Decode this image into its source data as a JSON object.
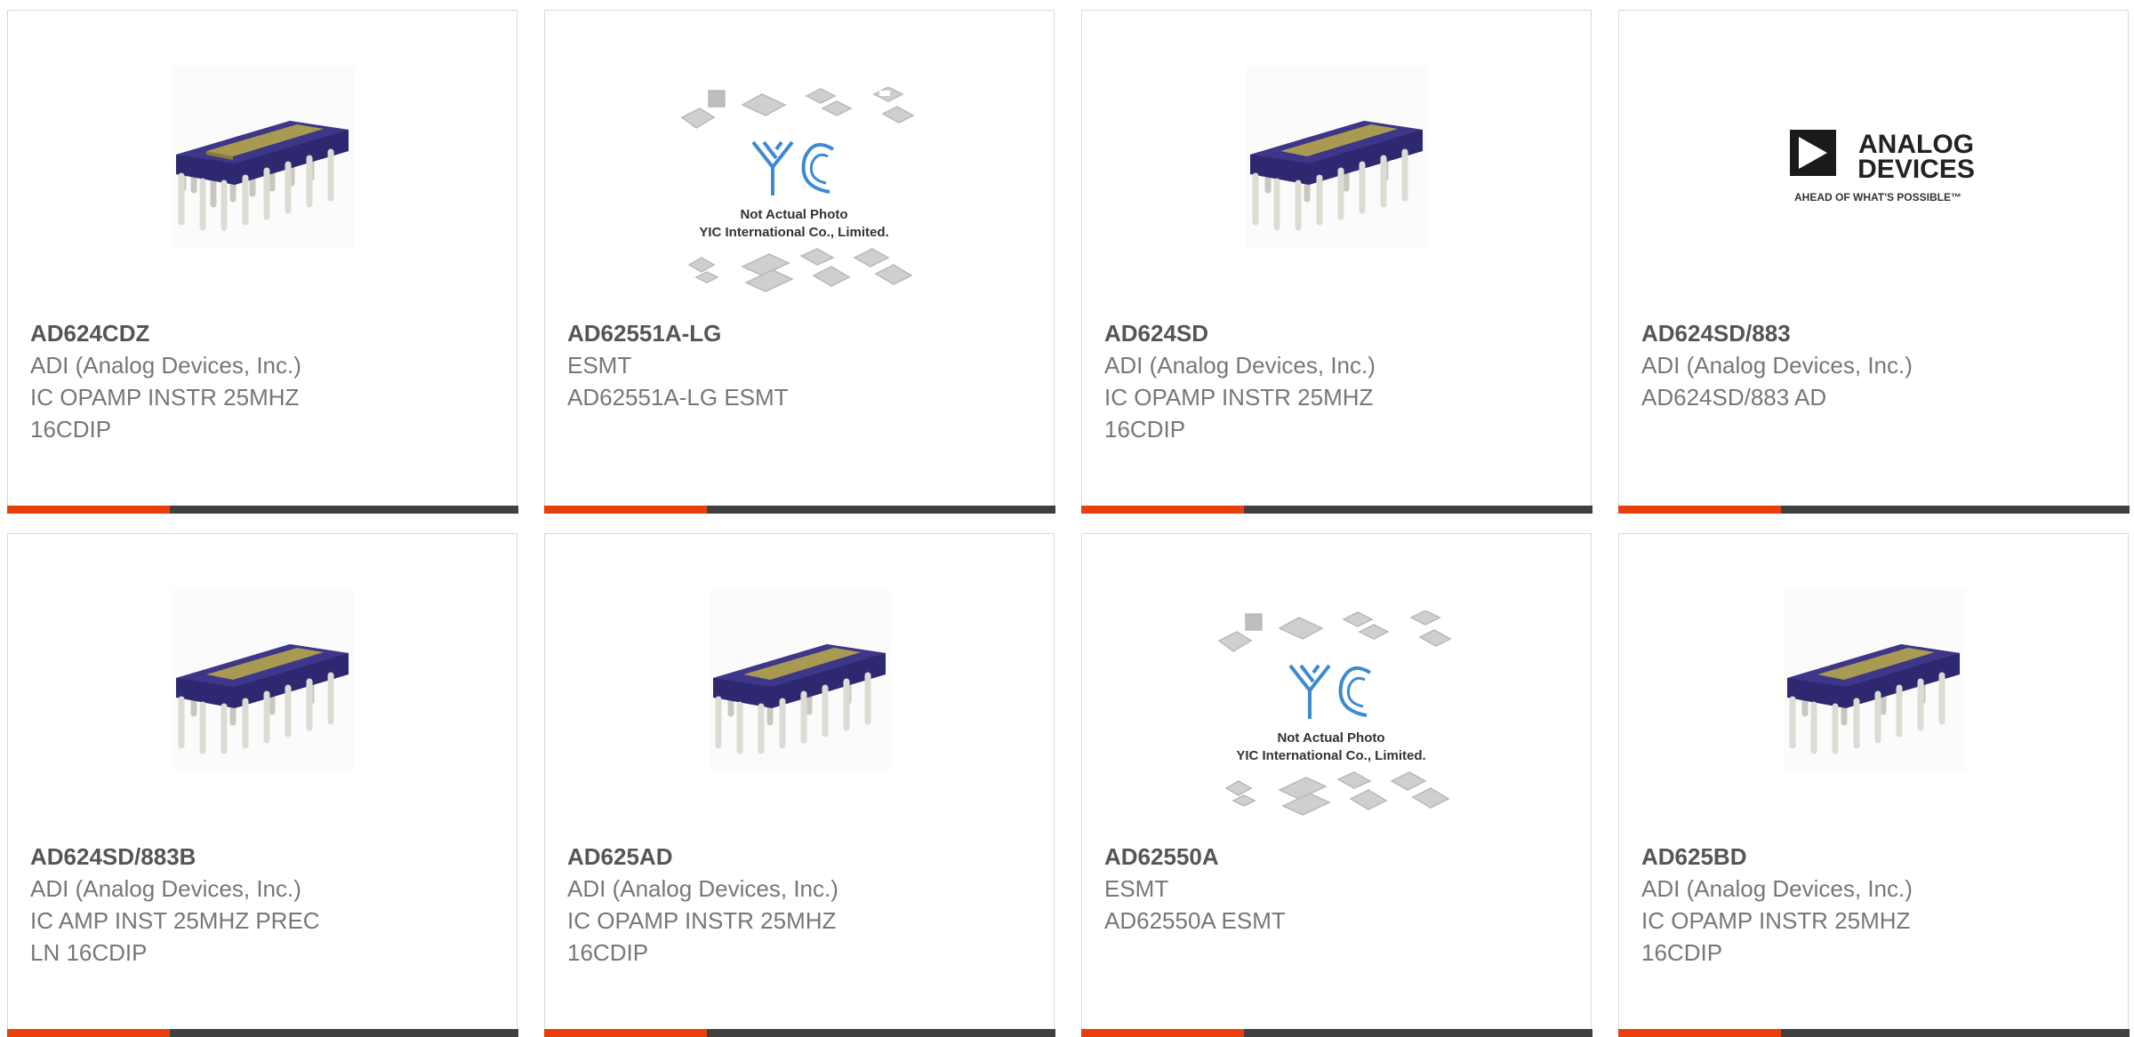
{
  "colors": {
    "accent": "#e8400c",
    "bar": "#404040",
    "border": "#d9d9d9",
    "title": "#555555",
    "text": "#777777"
  },
  "products": [
    {
      "part_number": "AD624CDZ",
      "manufacturer": "ADI (Analog Devices, Inc.)",
      "description": "IC OPAMP INSTR 25MHZ 16CDIP",
      "image": "dip-chip-photo"
    },
    {
      "part_number": "AD62551A-LG",
      "manufacturer": "ESMT",
      "description": "AD62551A-LG ESMT",
      "image": "yic-placeholder"
    },
    {
      "part_number": "AD624SD",
      "manufacturer": "ADI (Analog Devices, Inc.)",
      "description": "IC OPAMP INSTR 25MHZ 16CDIP",
      "image": "dip-chip-photo"
    },
    {
      "part_number": "AD624SD/883",
      "manufacturer": "ADI (Analog Devices, Inc.)",
      "description": "AD624SD/883 AD",
      "image": "analog-devices-logo"
    },
    {
      "part_number": "AD624SD/883B",
      "manufacturer": "ADI (Analog Devices, Inc.)",
      "description": "IC AMP INST 25MHZ PREC LN 16CDIP",
      "image": "dip-chip-photo"
    },
    {
      "part_number": "AD625AD",
      "manufacturer": "ADI (Analog Devices, Inc.)",
      "description": "IC OPAMP INSTR 25MHZ 16CDIP",
      "image": "dip-chip-photo"
    },
    {
      "part_number": "AD62550A",
      "manufacturer": "ESMT",
      "description": "AD62550A ESMT",
      "image": "yic-placeholder"
    },
    {
      "part_number": "AD625BD",
      "manufacturer": "ADI (Analog Devices, Inc.)",
      "description": "IC OPAMP INSTR 25MHZ 16CDIP",
      "image": "dip-chip-photo"
    }
  ],
  "placeholder_image": {
    "line1": "Not Actual Photo",
    "line2": "YIC International Co., Limited.",
    "logo_text": "YIC"
  },
  "analog_logo": {
    "line1": "ANALOG",
    "line2": "DEVICES",
    "tagline": "AHEAD OF WHAT'S POSSIBLE™"
  }
}
